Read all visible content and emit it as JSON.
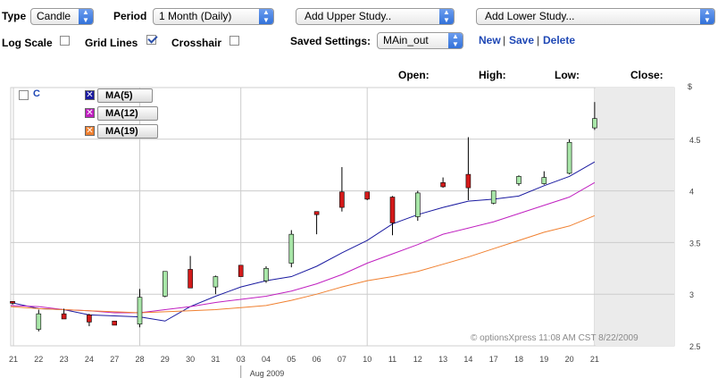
{
  "toolbar": {
    "type_label": "Type",
    "type_value": "Candle",
    "period_label": "Period",
    "period_value": "1 Month (Daily)",
    "upper_study": "Add Upper Study..",
    "lower_study": "Add Lower Study...",
    "log_scale_label": "Log Scale",
    "log_scale_checked": false,
    "grid_lines_label": "Grid Lines",
    "grid_lines_checked": true,
    "crosshair_label": "Crosshair",
    "crosshair_checked": false,
    "saved_settings_label": "Saved Settings:",
    "saved_settings_value": "MAin_out",
    "new_label": "New",
    "save_label": "Save",
    "delete_label": "Delete",
    "separator": "|"
  },
  "ohlc_header": {
    "open_label": "Open:",
    "high_label": "High:",
    "low_label": "Low:",
    "close_label": "Close:"
  },
  "legend": {
    "symbol": "C",
    "items": [
      {
        "label": "MA(5)",
        "color": "#1a1aa0"
      },
      {
        "label": "MA(12)",
        "color": "#c020c0"
      },
      {
        "label": "MA(19)",
        "color": "#f08030"
      }
    ]
  },
  "watermark": "© optionsXpress 11:08 AM CST 8/22/2009",
  "month_label": "Aug 2009",
  "colors": {
    "up": "#a8e6a8",
    "down": "#d41a1a",
    "future_shade": "#ebebeb"
  },
  "chart_data": {
    "type": "candlestick",
    "y_unit_label": "$",
    "ylim": [
      2.5,
      5.0
    ],
    "yticks": [
      2.5,
      3,
      3.5,
      4,
      4.5
    ],
    "grid": true,
    "x_ticks": [
      "21",
      "22",
      "23",
      "24",
      "27",
      "28",
      "29",
      "30",
      "31",
      "03",
      "04",
      "05",
      "06",
      "07",
      "10",
      "11",
      "12",
      "13",
      "14",
      "17",
      "18",
      "19",
      "20",
      "21"
    ],
    "candles": [
      {
        "x": "21",
        "open": 2.93,
        "high": 2.93,
        "low": 2.9,
        "close": 2.92
      },
      {
        "x": "22",
        "open": 2.66,
        "high": 2.85,
        "low": 2.64,
        "close": 2.81
      },
      {
        "x": "23",
        "open": 2.81,
        "high": 2.86,
        "low": 2.76,
        "close": 2.76
      },
      {
        "x": "24",
        "open": 2.8,
        "high": 2.81,
        "low": 2.69,
        "close": 2.73
      },
      {
        "x": "27",
        "open": 2.74,
        "high": 2.74,
        "low": 2.7,
        "close": 2.7
      },
      {
        "x": "28",
        "open": 2.71,
        "high": 3.05,
        "low": 2.68,
        "close": 2.97
      },
      {
        "x": "29",
        "open": 2.98,
        "high": 3.22,
        "low": 2.97,
        "close": 3.22
      },
      {
        "x": "30",
        "open": 3.24,
        "high": 3.37,
        "low": 3.1,
        "close": 3.06
      },
      {
        "x": "31",
        "open": 3.07,
        "high": 3.18,
        "low": 3.0,
        "close": 3.17
      },
      {
        "x": "03",
        "open": 3.28,
        "high": 3.28,
        "low": 3.17,
        "close": 3.17
      },
      {
        "x": "04",
        "open": 3.13,
        "high": 3.27,
        "low": 3.11,
        "close": 3.25
      },
      {
        "x": "05",
        "open": 3.3,
        "high": 3.62,
        "low": 3.26,
        "close": 3.58
      },
      {
        "x": "06",
        "open": 3.8,
        "high": 3.8,
        "low": 3.58,
        "close": 3.77
      },
      {
        "x": "07",
        "open": 3.99,
        "high": 4.23,
        "low": 3.8,
        "close": 3.84
      },
      {
        "x": "10",
        "open": 3.99,
        "high": 3.99,
        "low": 3.91,
        "close": 3.92
      },
      {
        "x": "11",
        "open": 3.94,
        "high": 3.95,
        "low": 3.57,
        "close": 3.69
      },
      {
        "x": "12",
        "open": 3.75,
        "high": 4.0,
        "low": 3.71,
        "close": 3.98
      },
      {
        "x": "13",
        "open": 4.08,
        "high": 4.13,
        "low": 4.03,
        "close": 4.04
      },
      {
        "x": "14",
        "open": 4.16,
        "high": 4.52,
        "low": 3.91,
        "close": 4.03
      },
      {
        "x": "17",
        "open": 3.88,
        "high": 4.0,
        "low": 3.87,
        "close": 4.0
      },
      {
        "x": "18",
        "open": 4.07,
        "high": 4.15,
        "low": 4.05,
        "close": 4.14
      },
      {
        "x": "19",
        "open": 4.07,
        "high": 4.19,
        "low": 4.06,
        "close": 4.13
      },
      {
        "x": "20",
        "open": 4.17,
        "high": 4.5,
        "low": 4.16,
        "close": 4.47
      },
      {
        "x": "21",
        "open": 4.61,
        "high": 4.86,
        "low": 4.59,
        "close": 4.7
      }
    ],
    "series": [
      {
        "name": "MA(5)",
        "color": "#1a1aa0",
        "values": [
          2.92,
          2.86,
          2.85,
          2.8,
          2.79,
          2.78,
          2.74,
          2.88,
          2.98,
          3.07,
          3.13,
          3.17,
          3.27,
          3.4,
          3.52,
          3.68,
          3.77,
          3.84,
          3.9,
          3.92,
          3.95,
          4.05,
          4.14,
          4.28
        ]
      },
      {
        "name": "MA(12)",
        "color": "#c020c0",
        "values": [
          2.89,
          2.88,
          2.85,
          2.84,
          2.82,
          2.82,
          2.85,
          2.88,
          2.92,
          2.95,
          2.98,
          3.03,
          3.1,
          3.19,
          3.3,
          3.39,
          3.48,
          3.58,
          3.64,
          3.7,
          3.78,
          3.86,
          3.94,
          4.08
        ]
      },
      {
        "name": "MA(19)",
        "color": "#f08030",
        "values": [
          2.88,
          2.86,
          2.85,
          2.84,
          2.83,
          2.82,
          2.83,
          2.84,
          2.85,
          2.87,
          2.89,
          2.94,
          3.0,
          3.07,
          3.13,
          3.17,
          3.22,
          3.29,
          3.36,
          3.44,
          3.52,
          3.6,
          3.66,
          3.76
        ]
      }
    ]
  }
}
